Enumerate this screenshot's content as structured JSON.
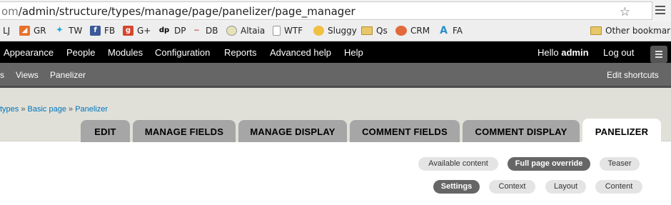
{
  "browser": {
    "url_host": "om",
    "url_path": "/admin/structure/types/manage/page/panelizer/page_manager",
    "bookmarks": [
      {
        "label": "LJ",
        "icon": "lj-icon"
      },
      {
        "label": "GR",
        "icon": "google-reader-icon"
      },
      {
        "label": "TW",
        "icon": "twitter-icon"
      },
      {
        "label": "FB",
        "icon": "facebook-icon"
      },
      {
        "label": "G+",
        "icon": "google-plus-icon"
      },
      {
        "label": "DP",
        "icon": "dp-icon"
      },
      {
        "label": "DB",
        "icon": "db-icon"
      },
      {
        "label": "Altaia",
        "icon": "globe-icon"
      },
      {
        "label": "WTF",
        "icon": "page-icon"
      },
      {
        "label": "Sluggy",
        "icon": "sluggy-icon"
      },
      {
        "label": "Qs",
        "icon": "folder-icon"
      },
      {
        "label": "CRM",
        "icon": "crm-icon"
      },
      {
        "label": "FA",
        "icon": "fa-icon"
      }
    ],
    "other_bookmarks": "Other bookmarks"
  },
  "toolbar": {
    "items": [
      "Appearance",
      "People",
      "Modules",
      "Configuration",
      "Reports",
      "Advanced help",
      "Help"
    ],
    "hello": "Hello ",
    "user": "admin",
    "logout": "Log out"
  },
  "shortcuts": {
    "items": [
      "s",
      "Views",
      "Panelizer"
    ],
    "edit": "Edit shortcuts"
  },
  "breadcrumb": {
    "items": [
      "types",
      "Basic page",
      "Panelizer"
    ],
    "sep": " » "
  },
  "tabs": [
    "EDIT",
    "MANAGE FIELDS",
    "MANAGE DISPLAY",
    "COMMENT FIELDS",
    "COMMENT DISPLAY",
    "PANELIZER"
  ],
  "view_modes": [
    "Available content",
    "Full page override",
    "Teaser"
  ],
  "subtabs": [
    "Settings",
    "Context",
    "Layout",
    "Content"
  ],
  "colors": {
    "toolbar_bg": "#000000",
    "shortcuts_bg": "#666666",
    "header_bg": "#e0e0d8",
    "tab_bg": "#a6a6a6",
    "link": "#0074bd",
    "pill_active": "#666666"
  }
}
